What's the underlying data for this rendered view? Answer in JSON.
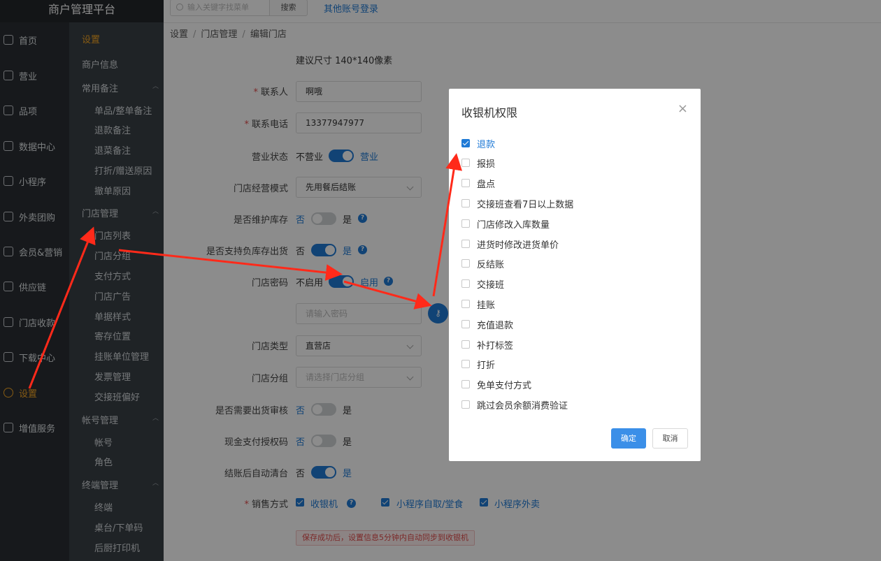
{
  "app": {
    "title": "商户管理平台"
  },
  "topbar": {
    "search_placeholder": "输入关键字找菜单",
    "search_button": "搜索",
    "other_login": "其他账号登录"
  },
  "breadcrumb": [
    "设置",
    "门店管理",
    "编辑门店"
  ],
  "nav": [
    {
      "label": "首页",
      "icon": "home-icon"
    },
    {
      "label": "营业",
      "icon": "calendar-icon"
    },
    {
      "label": "品项",
      "icon": "bag-icon"
    },
    {
      "label": "数据中心",
      "icon": "share-icon"
    },
    {
      "label": "小程序",
      "icon": "phone-icon"
    },
    {
      "label": "外卖团购",
      "icon": "bike-icon"
    },
    {
      "label": "会员&营销",
      "icon": "user-icon"
    },
    {
      "label": "供应链",
      "icon": "truck-icon"
    },
    {
      "label": "门店收款",
      "icon": "database-icon"
    },
    {
      "label": "下载中心",
      "icon": "download-icon"
    },
    {
      "label": "设置",
      "icon": "gear-icon",
      "active": true
    },
    {
      "label": "增值服务",
      "icon": "clock-icon"
    }
  ],
  "subnav": {
    "title": "设置",
    "merchant_info": "商户信息",
    "groups": [
      {
        "label": "常用备注",
        "items": [
          "单品/整单备注",
          "退款备注",
          "退菜备注",
          "打折/赠送原因",
          "撤单原因"
        ]
      },
      {
        "label": "门店管理",
        "items": [
          "门店列表",
          "门店分组",
          "支付方式",
          "门店广告",
          "单据样式",
          "寄存位置",
          "挂账单位管理",
          "发票管理",
          "交接班偏好"
        ]
      },
      {
        "label": "帐号管理",
        "items": [
          "帐号",
          "角色"
        ]
      },
      {
        "label": "终端管理",
        "items": [
          "终端",
          "桌台/下单码",
          "后厨打印机"
        ]
      }
    ]
  },
  "form": {
    "size_hint": "建议尺寸 140*140像素",
    "contact_label": "联系人",
    "contact_value": "啊哦",
    "phone_label": "联系电话",
    "phone_value": "13377947977",
    "status_label": "营业状态",
    "status_off": "不营业",
    "status_on": "营业",
    "mode_label": "门店经营模式",
    "mode_value": "先用餐后结账",
    "stock_label": "是否维护库存",
    "stock_no": "否",
    "stock_yes": "是",
    "negative_label": "是否支持负库存出货",
    "negative_no": "否",
    "negative_yes": "是",
    "password_label": "门店密码",
    "password_off": "不启用",
    "password_on": "启用",
    "password_placeholder": "请输入密码",
    "type_label": "门店类型",
    "type_value": "直营店",
    "group_label": "门店分组",
    "group_placeholder": "请选择门店分组",
    "audit_label": "是否需要出货审核",
    "audit_no": "否",
    "audit_yes": "是",
    "cash_label": "现金支付授权码",
    "cash_no": "否",
    "cash_yes": "是",
    "clear_label": "结账后自动清台",
    "clear_no": "否",
    "clear_yes": "是",
    "sales_label": "销售方式",
    "sales_options": [
      "收银机",
      "小程序自取/堂食",
      "小程序外卖"
    ],
    "save_tip": "保存成功后，设置信息5分钟内自动同步到收银机"
  },
  "dialog": {
    "title": "收银机权限",
    "permissions": [
      {
        "label": "退款",
        "checked": true
      },
      {
        "label": "报损",
        "checked": false
      },
      {
        "label": "盘点",
        "checked": false
      },
      {
        "label": "交接班查看7日以上数据",
        "checked": false
      },
      {
        "label": "门店修改入库数量",
        "checked": false
      },
      {
        "label": "进货时修改进货单价",
        "checked": false
      },
      {
        "label": "反结账",
        "checked": false
      },
      {
        "label": "交接班",
        "checked": false
      },
      {
        "label": "挂账",
        "checked": false
      },
      {
        "label": "充值退款",
        "checked": false
      },
      {
        "label": "补打标签",
        "checked": false
      },
      {
        "label": "打折",
        "checked": false
      },
      {
        "label": "免单支付方式",
        "checked": false
      },
      {
        "label": "跳过会员余额消费验证",
        "checked": false
      }
    ],
    "ok_label": "确定",
    "cancel_label": "取消"
  },
  "colors": {
    "accent": "#1f7ad6",
    "active_nav": "#f5a623",
    "arrow": "#ff2a1a"
  }
}
